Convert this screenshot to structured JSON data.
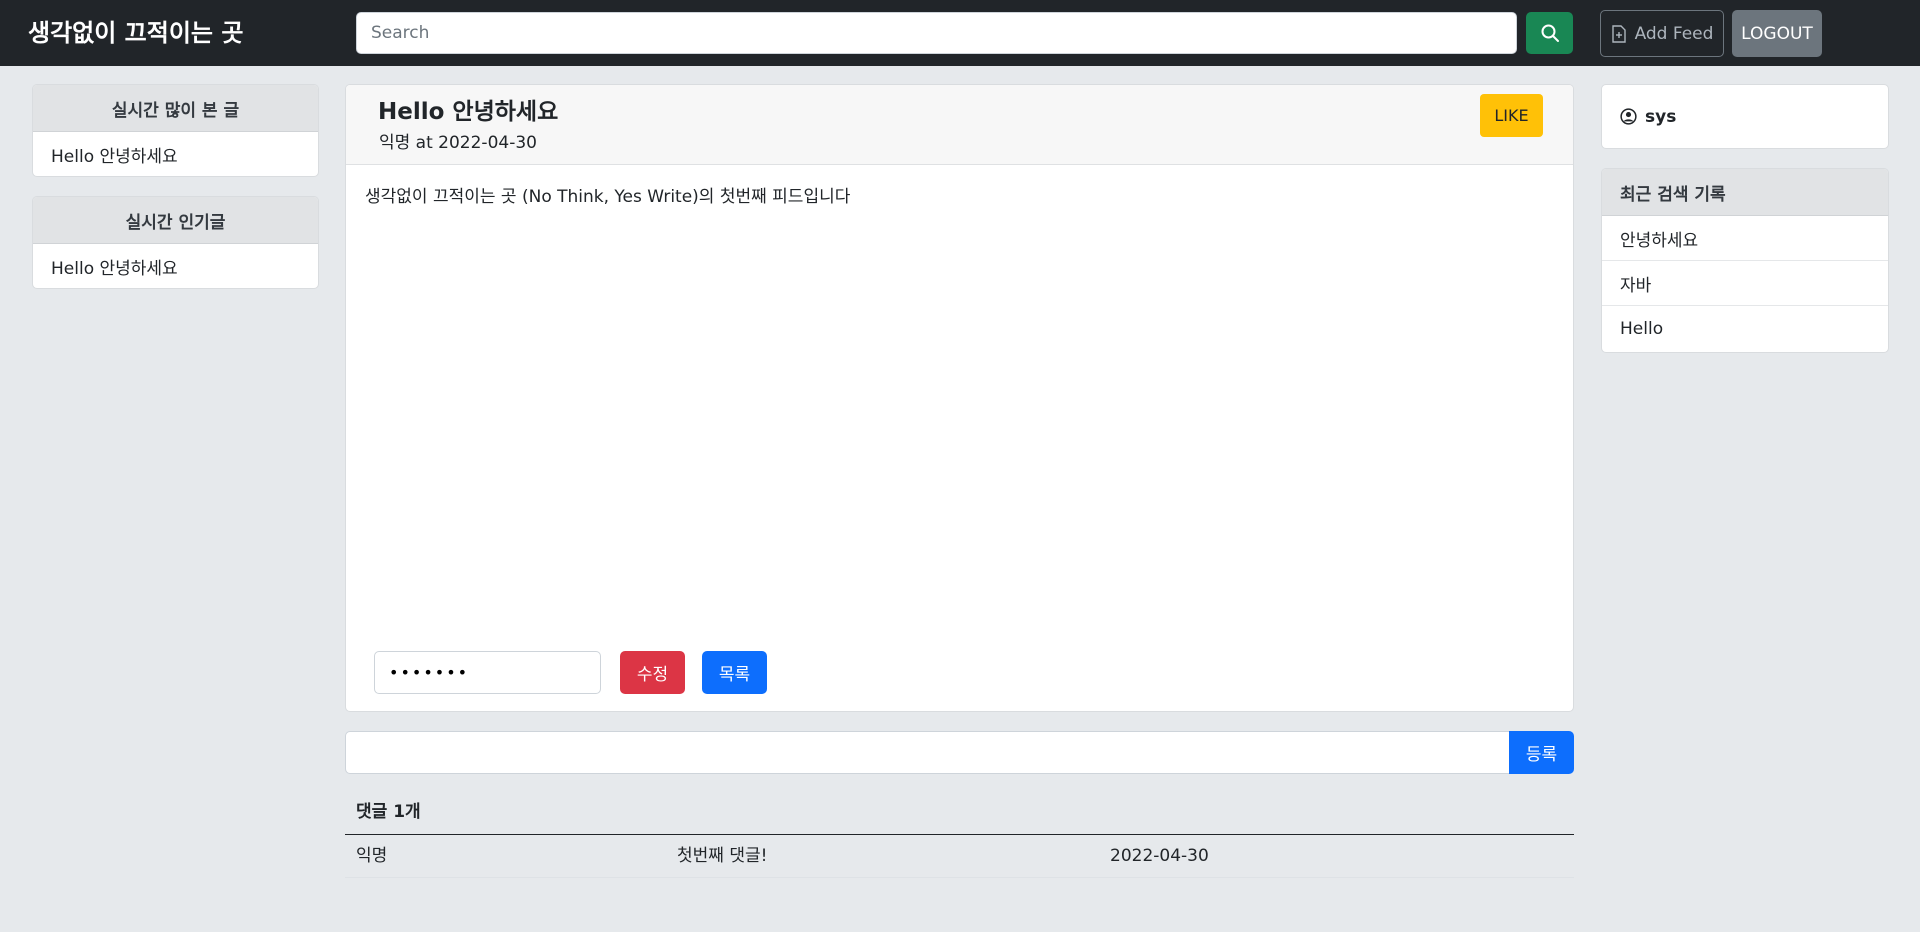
{
  "header": {
    "brand": "생각없이 끄적이는 곳",
    "search_placeholder": "Search",
    "add_feed_label": "Add Feed",
    "logout_label": "LOGOUT"
  },
  "left_sidebar": {
    "most_viewed": {
      "title": "실시간 많이 본 글",
      "items": [
        "Hello 안녕하세요"
      ]
    },
    "popular": {
      "title": "실시간 인기글",
      "items": [
        "Hello 안녕하세요"
      ]
    }
  },
  "post": {
    "title": "Hello 안녕하세요",
    "meta": "익명 at 2022-04-30",
    "like_label": "LIKE",
    "body": "생각없이 끄적이는 곳 (No Think, Yes Write)의 첫번째 피드입니다",
    "password_value": "•••••••",
    "edit_label": "수정",
    "list_label": "목록"
  },
  "comments": {
    "input_value": "",
    "submit_label": "등록",
    "count_label": "댓글 1개",
    "items": [
      {
        "author": "익명",
        "text": "첫번째 댓글!",
        "date": "2022-04-30"
      }
    ]
  },
  "right_sidebar": {
    "username": "sys",
    "history": {
      "title": "최근 검색 기록",
      "items": [
        "안녕하세요",
        "자바",
        "Hello"
      ]
    }
  }
}
